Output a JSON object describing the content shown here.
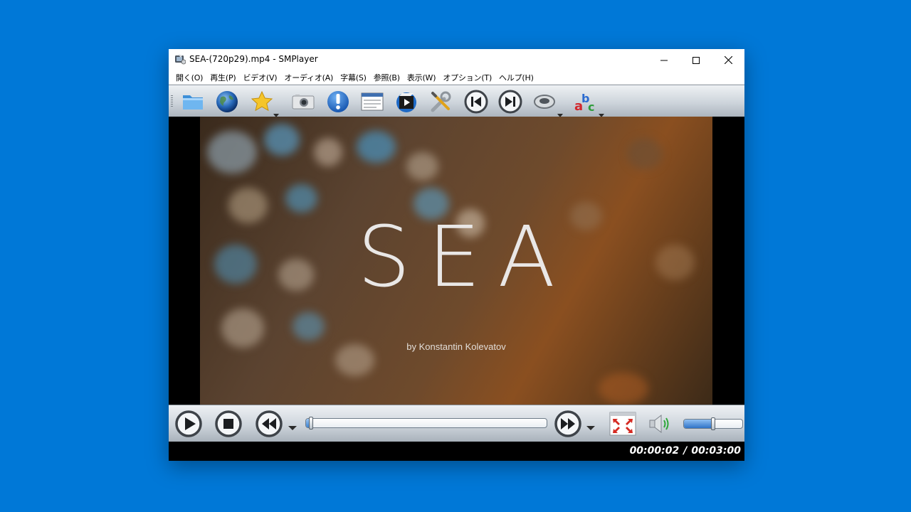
{
  "window": {
    "title": "SEA-(720p29).mp4 - SMPlayer",
    "minimize_icon": "minimize-icon",
    "maximize_icon": "maximize-icon",
    "close_icon": "close-icon"
  },
  "menu": {
    "items": [
      {
        "label": "開く(O)"
      },
      {
        "label": "再生(P)"
      },
      {
        "label": "ビデオ(V)"
      },
      {
        "label": "オーディオ(A)"
      },
      {
        "label": "字幕(S)"
      },
      {
        "label": "参照(B)"
      },
      {
        "label": "表示(W)"
      },
      {
        "label": "オプション(T)"
      },
      {
        "label": "ヘルプ(H)"
      }
    ]
  },
  "toolbar": {
    "icons": [
      "folder-open-icon",
      "globe-icon",
      "favorites-star-icon",
      "screenshot-camera-icon",
      "info-icon",
      "playlist-icon",
      "video-equalizer-icon",
      "preferences-tools-icon",
      "previous-track-icon",
      "next-track-icon",
      "audio-track-icon",
      "subtitle-track-icon"
    ]
  },
  "video": {
    "title": "SEA",
    "subtitle": "by Konstantin Kolevatov"
  },
  "controls": {
    "icons": [
      "play-icon",
      "stop-icon",
      "rewind-icon",
      "forward-icon",
      "fullscreen-icon",
      "speaker-icon"
    ],
    "seek_progress": 0.011,
    "volume_level": 0.5
  },
  "status": {
    "current_time": "00:00:02",
    "separator": "/",
    "total_time": "00:03:00"
  },
  "colors": {
    "desktop": "#0078d7",
    "accent_blue": "#2f73c7"
  }
}
